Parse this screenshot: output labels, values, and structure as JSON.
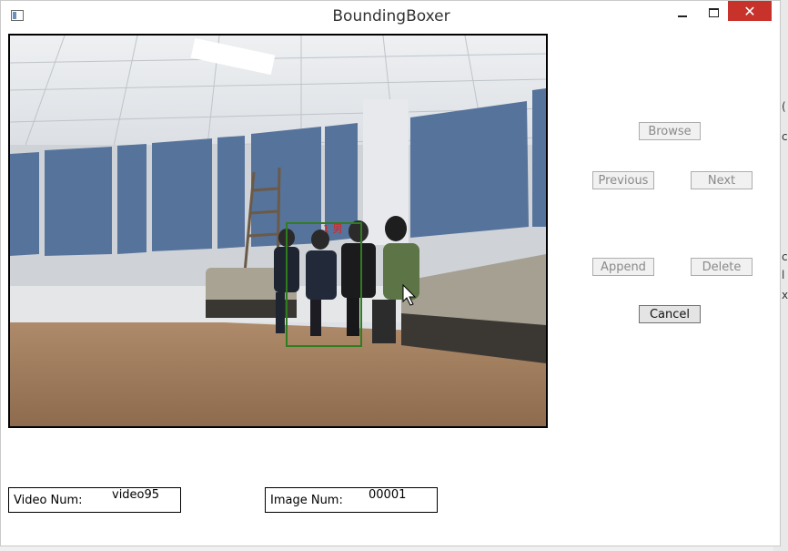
{
  "window": {
    "title": "BoundingBoxer",
    "close_glyph": "✕"
  },
  "image": {
    "box_label": "1 男"
  },
  "buttons": {
    "browse": "Browse",
    "previous": "Previous",
    "next": "Next",
    "append": "Append",
    "delete": "Delete",
    "cancel": "Cancel"
  },
  "fields": {
    "video_label": "Video Num:",
    "video_value": "video95",
    "image_label": "Image Num:",
    "image_value": "00001"
  },
  "background_window": {
    "fragments": [
      "(",
      "c",
      "c",
      "l",
      "x"
    ]
  }
}
